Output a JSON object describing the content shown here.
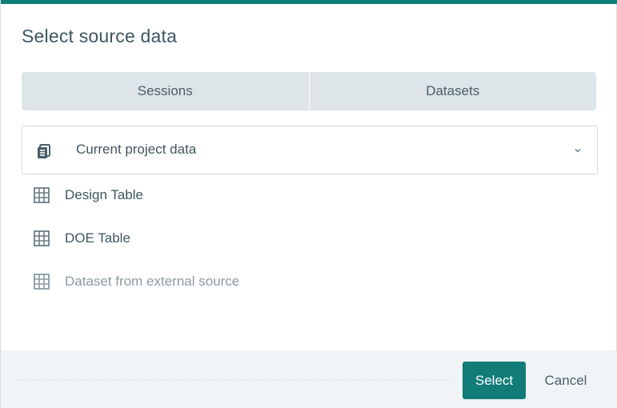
{
  "dialog": {
    "title": "Select source data",
    "accent_color": "#0f7f7c"
  },
  "tabs": [
    {
      "label": "Sessions"
    },
    {
      "label": "Datasets"
    }
  ],
  "source_dropdown": {
    "icon": "database-icon",
    "selected_value": "Current project data",
    "chevron_icon": "chevron-down-icon"
  },
  "datasets": [
    {
      "label": "Design Table",
      "icon": "table-grid-icon",
      "enabled": true
    },
    {
      "label": "DOE Table",
      "icon": "table-grid-icon",
      "enabled": true
    },
    {
      "label": "Dataset from external source",
      "icon": "table-grid-icon",
      "enabled": false
    }
  ],
  "footer": {
    "select_label": "Select",
    "cancel_label": "Cancel",
    "primary_color": "#127c79"
  }
}
